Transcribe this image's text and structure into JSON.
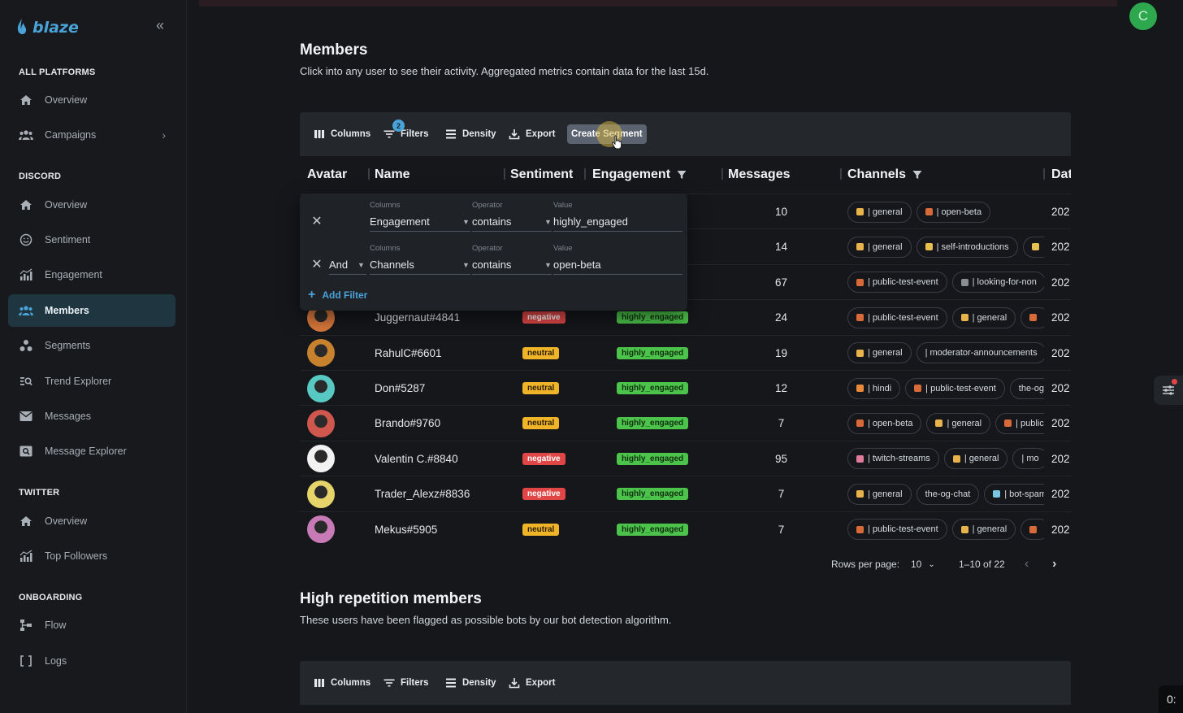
{
  "app": {
    "logo_text": "blaze",
    "user_initial": "C",
    "timer_text": "0:"
  },
  "sidebar": {
    "sections": [
      {
        "title": "ALL PLATFORMS",
        "items": [
          {
            "label": "Overview",
            "icon": "home-icon"
          },
          {
            "label": "Campaigns",
            "icon": "users-icon",
            "has_chevron": true
          }
        ]
      },
      {
        "title": "DISCORD",
        "items": [
          {
            "label": "Overview",
            "icon": "home-icon"
          },
          {
            "label": "Sentiment",
            "icon": "smile-icon"
          },
          {
            "label": "Engagement",
            "icon": "bar-chart-icon"
          },
          {
            "label": "Members",
            "icon": "users-icon",
            "active": true
          },
          {
            "label": "Segments",
            "icon": "segments-icon"
          },
          {
            "label": "Trend Explorer",
            "icon": "trend-search-icon"
          },
          {
            "label": "Messages",
            "icon": "mail-icon"
          },
          {
            "label": "Message Explorer",
            "icon": "message-search-icon"
          }
        ]
      },
      {
        "title": "TWITTER",
        "items": [
          {
            "label": "Overview",
            "icon": "home-icon"
          },
          {
            "label": "Top Followers",
            "icon": "bar-chart-icon"
          }
        ]
      },
      {
        "title": "ONBOARDING",
        "items": [
          {
            "label": "Flow",
            "icon": "flow-icon"
          },
          {
            "label": "Logs",
            "icon": "brackets-icon"
          }
        ]
      }
    ]
  },
  "members": {
    "title": "Members",
    "subtitle": "Click into any user to see their activity. Aggregated metrics contain data for the last 15d.",
    "toolbar": {
      "columns": "Columns",
      "filters": "Filters",
      "filter_count": "2",
      "density": "Density",
      "export": "Export",
      "create_segment": "Create Segment"
    },
    "headers": {
      "avatar": "Avatar",
      "name": "Name",
      "sentiment": "Sentiment",
      "engagement": "Engagement",
      "messages": "Messages",
      "channels": "Channels",
      "date": "Dat"
    },
    "rows": [
      {
        "name": "",
        "sentiment": "",
        "engagement": "",
        "messages": "10",
        "date": "202",
        "channels": [
          {
            "label": "| general",
            "color": "#e8b34a"
          },
          {
            "label": "| open-beta",
            "color": "#d86a3a"
          }
        ]
      },
      {
        "name": "",
        "sentiment": "",
        "engagement": "",
        "messages": "14",
        "date": "202",
        "channels": [
          {
            "label": "| general",
            "color": "#e8b34a"
          },
          {
            "label": "| self-introductions",
            "color": "#e8c050"
          },
          {
            "label": "",
            "color": "#e8c050"
          }
        ]
      },
      {
        "name": "",
        "sentiment": "",
        "engagement": "",
        "messages": "67",
        "date": "202",
        "channels": [
          {
            "label": "| public-test-event",
            "color": "#d86a3a"
          },
          {
            "label": "| looking-for-non",
            "color": "#8a8f96"
          }
        ]
      },
      {
        "name": "Juggernaut#4841",
        "sentiment": "negative",
        "engagement": "highly_engaged",
        "messages": "24",
        "date": "202",
        "avatar_color": "#d9783c",
        "channels": [
          {
            "label": "| public-test-event",
            "color": "#d86a3a"
          },
          {
            "label": "| general",
            "color": "#e8b34a"
          },
          {
            "label": "",
            "color": "#d86a3a"
          }
        ]
      },
      {
        "name": "RahulC#6601",
        "sentiment": "neutral",
        "engagement": "highly_engaged",
        "messages": "19",
        "date": "202",
        "avatar_color": "#c8822e",
        "channels": [
          {
            "label": "| general",
            "color": "#e8b34a"
          },
          {
            "label": "| moderator-announcements",
            "color": ""
          }
        ]
      },
      {
        "name": "Don#5287",
        "sentiment": "neutral",
        "engagement": "highly_engaged",
        "messages": "12",
        "date": "202",
        "avatar_color": "#58c9c2",
        "channels": [
          {
            "label": "| hindi",
            "color": "#e98a3a"
          },
          {
            "label": "| public-test-event",
            "color": "#d86a3a"
          },
          {
            "label": "the-og",
            "color": ""
          }
        ]
      },
      {
        "name": "Brando#9760",
        "sentiment": "neutral",
        "engagement": "highly_engaged",
        "messages": "7",
        "date": "202",
        "avatar_color": "#d0574e",
        "channels": [
          {
            "label": "| open-beta",
            "color": "#d86a3a"
          },
          {
            "label": "| general",
            "color": "#e8b34a"
          },
          {
            "label": "| public",
            "color": "#d86a3a"
          }
        ]
      },
      {
        "name": "Valentin C.#8840",
        "sentiment": "negative",
        "engagement": "highly_engaged",
        "messages": "95",
        "date": "202",
        "avatar_color": "#f2f2f2",
        "channels": [
          {
            "label": "| twitch-streams",
            "color": "#e07a9a"
          },
          {
            "label": "| general",
            "color": "#e8b34a"
          },
          {
            "label": "| mo",
            "color": ""
          }
        ]
      },
      {
        "name": "Trader_Alexz#8836",
        "sentiment": "negative",
        "engagement": "highly_engaged",
        "messages": "7",
        "date": "202",
        "avatar_color": "#e6d46a",
        "channels": [
          {
            "label": "| general",
            "color": "#e8b34a"
          },
          {
            "label": "the-og-chat",
            "color": ""
          },
          {
            "label": "| bot-spam",
            "color": "#7ac6e0"
          }
        ]
      },
      {
        "name": "Mekus#5905",
        "sentiment": "neutral",
        "engagement": "highly_engaged",
        "messages": "7",
        "date": "202",
        "avatar_color": "#c77ab6",
        "channels": [
          {
            "label": "| public-test-event",
            "color": "#d86a3a"
          },
          {
            "label": "| general",
            "color": "#e8b34a"
          },
          {
            "label": "",
            "color": "#d86a3a"
          }
        ]
      }
    ],
    "filter_popup": {
      "filters": [
        {
          "conjunction": "",
          "columns_label": "Columns",
          "column": "Engagement",
          "operator_label": "Operator",
          "operator": "contains",
          "value_label": "Value",
          "value": "highly_engaged"
        },
        {
          "conjunction": "And",
          "columns_label": "Columns",
          "column": "Channels",
          "operator_label": "Operator",
          "operator": "contains",
          "value_label": "Value",
          "value": "open-beta"
        }
      ],
      "add_filter": "Add Filter"
    },
    "pagination": {
      "rows_per_page_label": "Rows per page:",
      "rows_per_page": "10",
      "range": "1–10 of 22"
    }
  },
  "high_repetition": {
    "title": "High repetition members",
    "subtitle": "These users have been flagged as possible bots by our bot detection algorithm.",
    "toolbar": {
      "columns": "Columns",
      "filters": "Filters",
      "density": "Density",
      "export": "Export"
    }
  },
  "colors": {
    "accent": "#4aa3d8",
    "negative": "#e04646",
    "neutral": "#f0b429",
    "engaged": "#4cc34a"
  }
}
